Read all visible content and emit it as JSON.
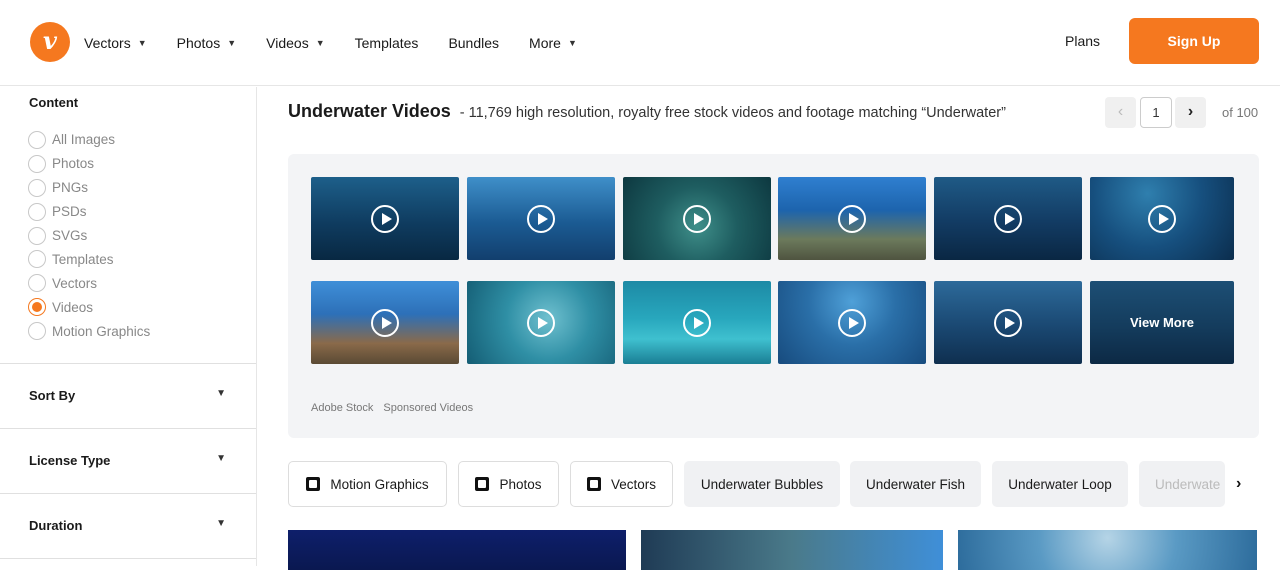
{
  "header": {
    "logo_glyph": "v",
    "nav": [
      {
        "label": "Vectors",
        "has_dropdown": true
      },
      {
        "label": "Photos",
        "has_dropdown": true
      },
      {
        "label": "Videos",
        "has_dropdown": true
      },
      {
        "label": "Templates",
        "has_dropdown": false
      },
      {
        "label": "Bundles",
        "has_dropdown": false
      },
      {
        "label": "More",
        "has_dropdown": true
      }
    ],
    "plans_label": "Plans",
    "signup_label": "Sign Up",
    "accent_color": "#f5781f"
  },
  "sidebar": {
    "content_title": "Content",
    "content_options": [
      "All Images",
      "Photos",
      "PNGs",
      "PSDs",
      "SVGs",
      "Templates",
      "Vectors",
      "Videos",
      "Motion Graphics"
    ],
    "selected_content": "Videos",
    "filters": [
      "Sort By",
      "License Type",
      "Duration"
    ]
  },
  "main": {
    "title": "Underwater Videos",
    "subtitle": "- 11,769 high resolution, royalty free stock videos and footage matching “Underwater”",
    "pager": {
      "current": "1",
      "of_label": "of 100",
      "prev_icon": "chevron-left-icon",
      "next_icon": "chevron-right-icon"
    },
    "sponsored": {
      "view_more_label": "View More",
      "footer_source": "Adobe Stock",
      "footer_label": "Sponsored Videos"
    },
    "chips": [
      {
        "label": "Motion Graphics",
        "icon": "motion-graphics-icon"
      },
      {
        "label": "Photos",
        "icon": "photo-icon"
      },
      {
        "label": "Vectors",
        "icon": "vector-icon"
      },
      {
        "label": "Underwater Bubbles"
      },
      {
        "label": "Underwater Fish"
      },
      {
        "label": "Underwater Loop"
      },
      {
        "label": "Underwate"
      }
    ]
  }
}
